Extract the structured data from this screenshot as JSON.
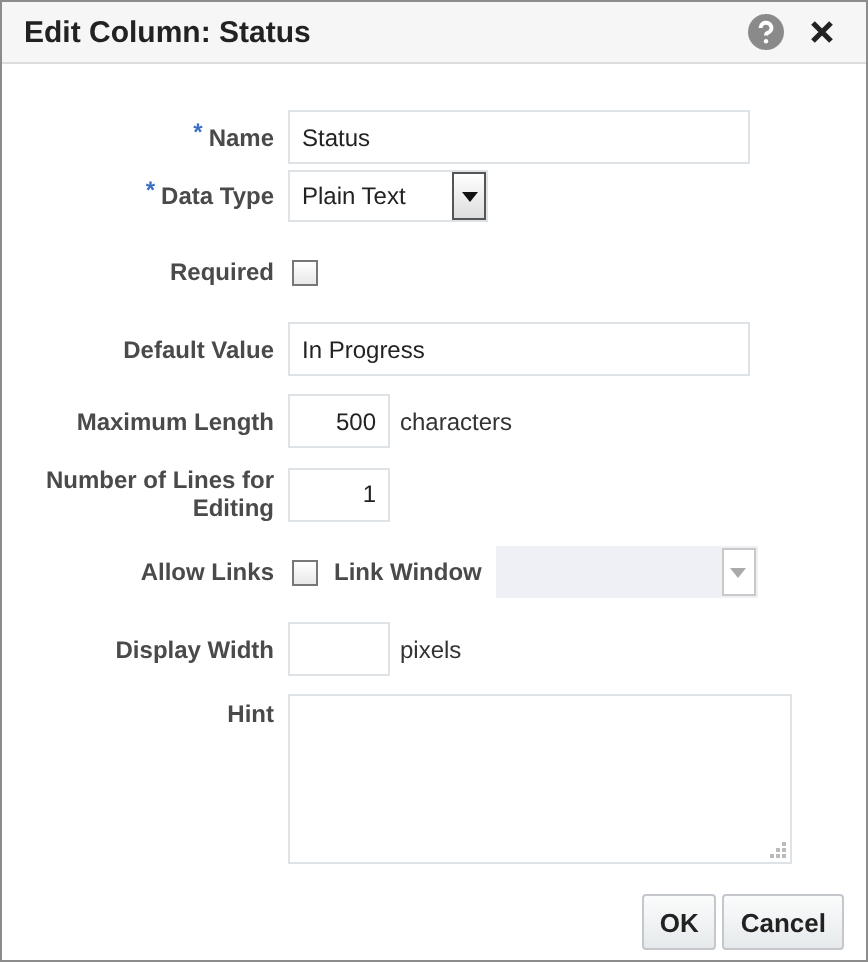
{
  "dialog": {
    "title": "Edit Column: Status"
  },
  "fields": [
    {
      "kind": "text",
      "label": "Name",
      "required_mark": "*",
      "value": "Status"
    },
    {
      "kind": "select",
      "label": "Data Type",
      "required_mark": "*",
      "value": "Plain Text",
      "disabled": false
    },
    {
      "kind": "checkbox",
      "label": "Required",
      "checked": false
    },
    {
      "kind": "text",
      "label": "Default Value",
      "value": "In Progress"
    },
    {
      "kind": "number",
      "label": "Maximum Length",
      "value": "500",
      "suffix": "characters"
    },
    {
      "kind": "number",
      "label": "Number of Lines for Editing",
      "value": "1"
    },
    {
      "kind": "checkbox",
      "label": "Allow Links",
      "checked": false,
      "extra": {
        "kind": "select",
        "label": "Link Window",
        "disabled": true
      }
    },
    {
      "kind": "number",
      "label": "Display Width",
      "suffix": "pixels"
    },
    {
      "kind": "textarea",
      "label": "Hint"
    }
  ],
  "buttons": [
    "OK",
    "Cancel"
  ]
}
